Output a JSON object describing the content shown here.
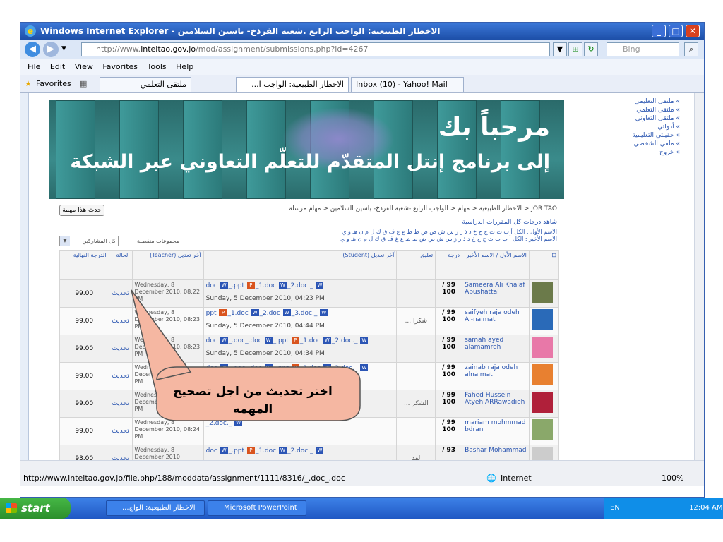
{
  "window": {
    "title": "الاخطار الطبيعية: الواجب الرابع .شعبة الفرذخ- ياسين السلامين - Windows Internet Explorer",
    "minimize": "_",
    "maximize": "□",
    "close": "✕"
  },
  "address": {
    "url_pre": "http://www.",
    "url_domain": "inteltao.gov.jo",
    "url_post": "/mod/assignment/submissions.php?id=4267",
    "search_placeholder": "Bing"
  },
  "menu": [
    "File",
    "Edit",
    "View",
    "Favorites",
    "Tools",
    "Help"
  ],
  "favorites": {
    "label": "Favorites",
    "tabs": [
      "ملتقى التعلمي",
      "الاخطار الطبيعية: الواجب ا...",
      "Inbox (10) - Yahoo! Mail"
    ]
  },
  "banner": {
    "line1": "مرحباً بك",
    "line2": "إلى برنامج إنتل المتقدّم للتعلّم التعاوني عبر الشبكة"
  },
  "sidemenu": [
    "» ملتقى التعليمي",
    "» ملتقى التعلمي",
    "» ملتقى التعاوني",
    "» أدواتي",
    "» حقيبتي التعليمية",
    "» ملفي الشخصي",
    "» خروج"
  ],
  "page": {
    "update_button": "حدث هذا مهمة",
    "breadcrumb": "JOR TAO < الاخطار الطبيعية < مهام < الواجب الرابع -شعبة الفرذخ- ياسين السلامين < مهام مرسلة",
    "view_grades": "شاهد درجات كل المقررات الدراسية",
    "first_name": "الاسم الأول : الكل أ ب ت ث ج ح خ د ذ ر ز س ش ص ض ط ظ ع غ ف ق ك ل م ن هـ و ي",
    "last_name": "الاسم الأخير : الكل أ ب ت ث ج ح خ د ذ ر ز س ش ص ض ط ظ ع غ ف ق ك ل م ن هـ و ي",
    "groups_label": "مجموعات منفصلة",
    "groups_value": "كل المشاركين"
  },
  "table": {
    "headers": {
      "pic": "⊟",
      "name": "الاسم الأول / الاسم الأخير",
      "grade": "درجة",
      "comment": "تعليق",
      "student": "آخر تعديل (Student)",
      "teacher": "آخر تعديل (Teacher)",
      "status": "الحالة",
      "final": "الدرجة النهائية"
    },
    "rows": [
      {
        "name": "Sameera Ali Khalaf Abushattal",
        "grade": "/ 99",
        "max": "100",
        "comment": "",
        "files": "doc _.ppt _1.doc _2.doc._",
        "sdate": "Sunday, 5 December 2010, 04:23 PM",
        "tdate": "Wednesday, 8 December 2010, 08:22 PM",
        "status": "تحديث",
        "final": "99.00",
        "pic": "#6b7a4a"
      },
      {
        "name": "saifyeh raja odeh Al-naimat",
        "grade": "/ 99",
        "max": "100",
        "comment": "شكرا ...",
        "files": "ppt _1.doc _2.doc _3.doc._",
        "sdate": "Sunday, 5 December 2010, 04:44 PM",
        "tdate": "Wednesday, 8 December 2010, 08:23 PM",
        "status": "تحديث",
        "final": "99.00",
        "pic": "#2a6ab8"
      },
      {
        "name": "samah ayed alamamreh",
        "grade": "/ 99",
        "max": "100",
        "comment": "",
        "files": "doc _.doc_.doc _.ppt _1.doc _2.doc._",
        "sdate": "Sunday, 5 December 2010, 04:34 PM",
        "tdate": "Wednesday, 8 December 2010, 08:23 PM",
        "status": "تحديث",
        "final": "99.00",
        "pic": "#e878a8"
      },
      {
        "name": "zainab raja odeh alnaimat",
        "grade": "/ 99",
        "max": "100",
        "comment": "",
        "files": "doc _.doc_.doc _.ppt _1.doc _2.doc._",
        "sdate": "Sunday, 5 December 2010, 05:29 PM",
        "tdate": "Wednesday, 8 December 2010, 08:23 PM",
        "status": "تحديث",
        "final": "99.00",
        "pic": "#e88030"
      },
      {
        "name": "Fahed Hussein Atyeh ARRawadieh",
        "grade": "/ 99",
        "max": "100",
        "comment": "الشكر ...",
        "files": "",
        "sdate": "",
        "tdate": "Wednesday, 8 December 2010, 08:23 PM",
        "status": "تحديث",
        "final": "99.00",
        "pic": "#b0203a"
      },
      {
        "name": "mariam mohmmad bdran",
        "grade": "/ 99",
        "max": "100",
        "comment": "",
        "files": "_2.doc._",
        "sdate": "",
        "tdate": "Wednesday, 8 December 2010, 08:24 PM",
        "status": "تحديث",
        "final": "99.00",
        "pic": "#8aa86a"
      },
      {
        "name": "Bashar Mohammad",
        "grade": "/ 93",
        "max": "",
        "comment": "لقد",
        "files": "doc _.ppt _1.doc _2.doc._",
        "sdate": "",
        "tdate": "Wednesday, 8 December 2010",
        "status": "تحديث",
        "final": "93.00",
        "pic": "#cccccc"
      }
    ]
  },
  "callout": {
    "line1": "اختر تحديث من اجل تصحيح",
    "line2": "المهمه"
  },
  "status": {
    "url": "http://www.inteltao.gov.jo/file.php/188/moddata/assignment/1111/8316/_.doc_.doc",
    "zone": "Internet",
    "zoom": "100%"
  },
  "taskbar": {
    "start": "start",
    "task1": "الاخطار الطبيعية: الواج...",
    "task2": "Microsoft PowerPoint ...",
    "lang": "EN",
    "time": "12:04 AM"
  }
}
